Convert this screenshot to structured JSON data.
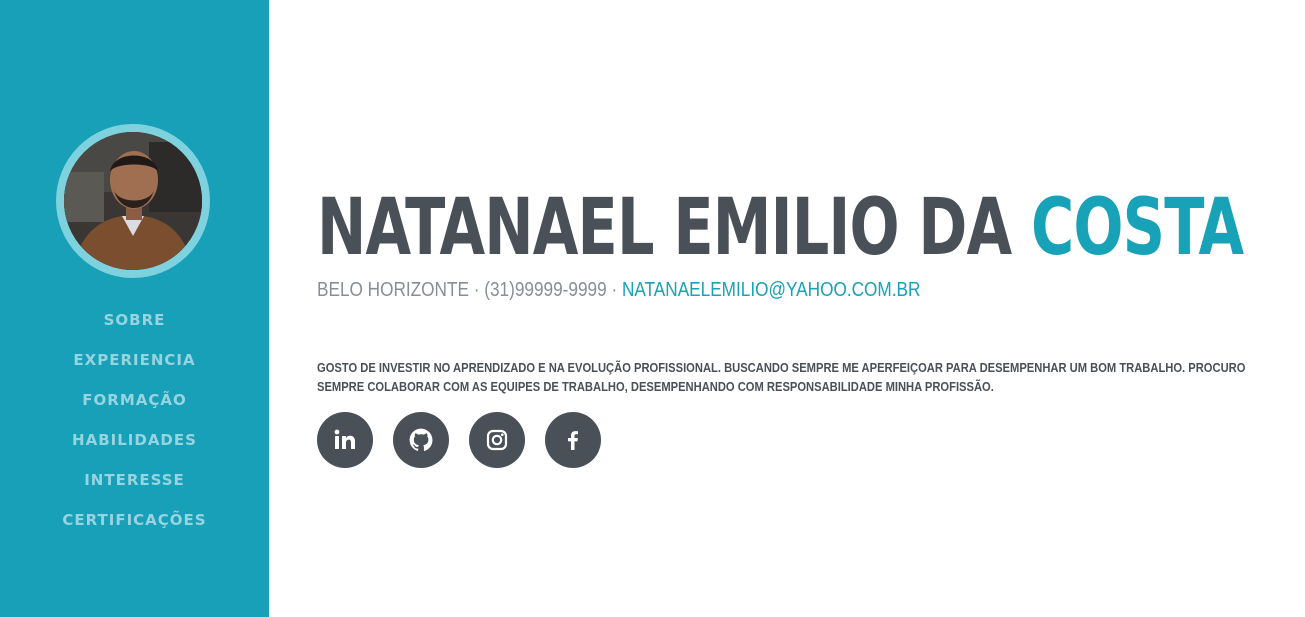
{
  "profile": {
    "first_names": "NATANAEL EMILIO DA",
    "last_name": "COSTA",
    "city": "BELO HORIZONTE",
    "separator": " · ",
    "phone": "(31)99999-9999",
    "email": "NATANAELEMILIO@YAHOO.COM.BR",
    "about": "GOSTO DE INVESTIR NO APRENDIZADO E NA EVOLUÇÃO PROFISSIONAL. BUSCANDO SEMPRE ME APERFEIÇOAR PARA DESEMPENHAR UM BOM TRABALHO. PROCURO SEMPRE COLABORAR COM AS EQUIPES DE TRABALHO, DESEMPENHANDO COM RESPONSABILIDADE MINHA PROFISSÃO."
  },
  "nav": {
    "items": [
      "SOBRE",
      "EXPERIENCIA",
      "FORMAÇÃO",
      "HABILIDADES",
      "INTERESSE",
      "CERTIFICAÇÕES"
    ]
  },
  "social": {
    "icons": [
      "linkedin-icon",
      "github-icon",
      "instagram-icon",
      "facebook-icon"
    ]
  },
  "colors": {
    "sidebar": "#18a0b8",
    "accent": "#17a2b8",
    "text": "#495057",
    "muted": "#868e96",
    "avatar_ring": "#7ed2de"
  }
}
